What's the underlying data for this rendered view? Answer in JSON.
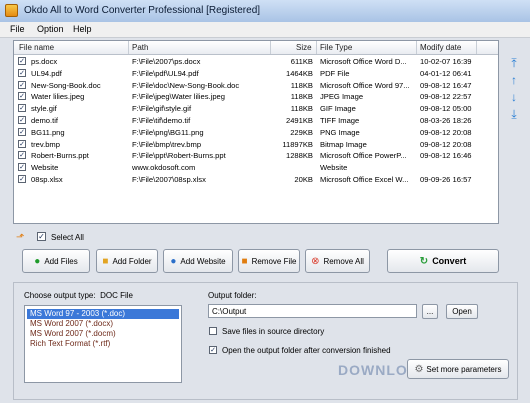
{
  "window": {
    "title": "Okdo All to Word Converter Professional [Registered]"
  },
  "menu": [
    "File",
    "Option",
    "Help"
  ],
  "table": {
    "columns": [
      "File name",
      "Path",
      "Size",
      "File Type",
      "Modify date"
    ],
    "rows": [
      {
        "name": "ps.docx",
        "path": "F:\\File\\2007\\ps.docx",
        "size": "611KB",
        "type": "Microsoft Office Word D...",
        "date": "10-02-07 16:39"
      },
      {
        "name": "UL94.pdf",
        "path": "F:\\File\\pdf\\UL94.pdf",
        "size": "1464KB",
        "type": "PDF File",
        "date": "04-01-12 06:41"
      },
      {
        "name": "New-Song-Book.doc",
        "path": "F:\\File\\doc\\New-Song-Book.doc",
        "size": "118KB",
        "type": "Microsoft Office Word 97...",
        "date": "09-08-12 16:47"
      },
      {
        "name": "Water lilies.jpeg",
        "path": "F:\\File\\jpeg\\Water lilies.jpeg",
        "size": "118KB",
        "type": "JPEG Image",
        "date": "09-08-12 22:57"
      },
      {
        "name": "style.gif",
        "path": "F:\\File\\gif\\style.gif",
        "size": "118KB",
        "type": "GIF Image",
        "date": "09-08-12 05:00"
      },
      {
        "name": "demo.tif",
        "path": "F:\\File\\tif\\demo.tif",
        "size": "2491KB",
        "type": "TIFF Image",
        "date": "08-03-26 18:26"
      },
      {
        "name": "BG11.png",
        "path": "F:\\File\\png\\BG11.png",
        "size": "229KB",
        "type": "PNG Image",
        "date": "09-08-12 20:08"
      },
      {
        "name": "trev.bmp",
        "path": "F:\\File\\bmp\\trev.bmp",
        "size": "11897KB",
        "type": "Bitmap Image",
        "date": "09-08-12 20:08"
      },
      {
        "name": "Robert-Burns.ppt",
        "path": "F:\\File\\ppt\\Robert-Burns.ppt",
        "size": "1288KB",
        "type": "Microsoft Office PowerP...",
        "date": "09-08-12 16:46"
      },
      {
        "name": "Website",
        "path": "www.okdosoft.com",
        "size": "",
        "type": "Website",
        "date": ""
      },
      {
        "name": "08sp.xlsx",
        "path": "F:\\File\\2007\\08sp.xlsx",
        "size": "20KB",
        "type": "Microsoft Office Excel W...",
        "date": "09-09-26 16:57"
      }
    ]
  },
  "select_all_label": "Select All",
  "buttons": {
    "add_files": "Add Files",
    "add_folder": "Add Folder",
    "add_website": "Add Website",
    "remove_file": "Remove File",
    "remove_all": "Remove All",
    "convert": "Convert"
  },
  "output": {
    "type_label": "Choose output type:",
    "type_value": "DOC File",
    "types": [
      "MS Word 97 - 2003 (*.doc)",
      "MS Word 2007 (*.docx)",
      "MS Word 2007 (*.docm)",
      "Rich Text Format (*.rtf)"
    ],
    "selected_index": 0,
    "folder_label": "Output folder:",
    "folder_value": "C:\\Output",
    "browse_label": "...",
    "open_label": "Open",
    "save_in_source_label": "Save files in source directory",
    "save_in_source_checked": false,
    "open_after_label": "Open the output folder after conversion finished",
    "open_after_checked": true,
    "more_params_label": "Set more parameters"
  },
  "watermark": "DOWNLOAD.COM.VN"
}
